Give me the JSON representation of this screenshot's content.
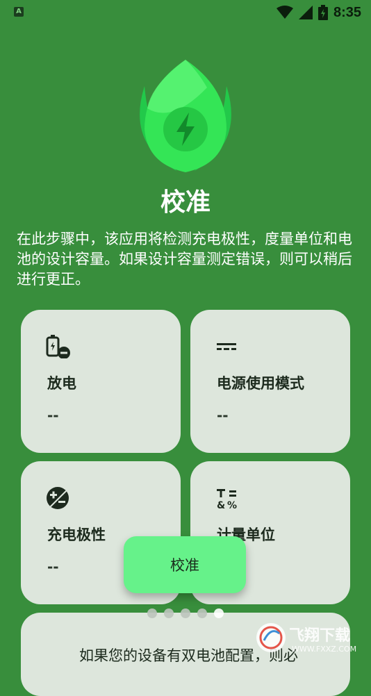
{
  "status_bar": {
    "time": "8:35",
    "app_icon_letter": "A"
  },
  "title": "校准",
  "description": "在此步骤中，该应用将检测充电极性，度量单位和电池的设计容量。如果设计容量测定错误，则可以稍后进行更正。",
  "cards": [
    {
      "label": "放电",
      "value": "--",
      "icon": "battery-discharge-icon"
    },
    {
      "label": "电源使用模式",
      "value": "--",
      "icon": "dc-power-icon"
    },
    {
      "label": "充电极性",
      "value": "--",
      "icon": "exposure-plus-minus-icon"
    },
    {
      "label": "计量单位",
      "value": "--",
      "icon": "calculate-icon"
    }
  ],
  "info_card": {
    "text": "如果您的设备有双电池配置，则必"
  },
  "calibrate_button": {
    "label": "校准"
  },
  "pager": {
    "count": 5,
    "active_index": 4
  },
  "watermark": {
    "text": "飞翔下载",
    "url": "WWW.FXXZ.COM"
  },
  "colors": {
    "background": "#388e3c",
    "card": "#dde6dc",
    "button": "#66f28a"
  }
}
